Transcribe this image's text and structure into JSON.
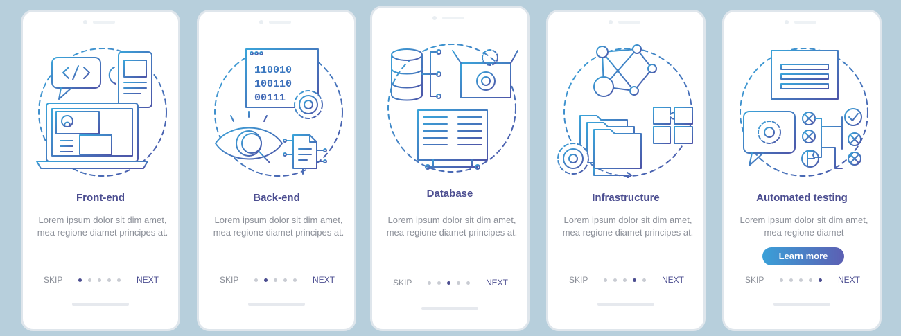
{
  "screens": [
    {
      "title": "Front-end",
      "desc": "Lorem ipsum dolor sit dim amet, mea regione diamet principes at.",
      "skip": "SKIP",
      "next": "NEXT",
      "active_page": 1
    },
    {
      "title": "Back-end",
      "desc": "Lorem ipsum dolor sit dim amet, mea regione diamet principes at.",
      "skip": "SKIP",
      "next": "NEXT",
      "active_page": 2
    },
    {
      "title": "Database",
      "desc": "Lorem ipsum dolor sit dim amet, mea regione diamet principes at.",
      "skip": "SKIP",
      "next": "NEXT",
      "active_page": 3
    },
    {
      "title": "Infrastructure",
      "desc": "Lorem ipsum dolor sit dim amet, mea regione diamet principes at.",
      "skip": "SKIP",
      "next": "NEXT",
      "active_page": 4
    },
    {
      "title": "Automated testing",
      "desc": "Lorem ipsum dolor sit dim amet, mea regione diamet",
      "skip": "SKIP",
      "next": "NEXT",
      "active_page": 5,
      "button": "Learn more"
    }
  ],
  "page_count": 5,
  "icons": {
    "s1": [
      "code-chat-icon",
      "smartphone-icon",
      "laptop-icon",
      "user-profile-icon"
    ],
    "s2": [
      "binary-window-icon",
      "gear-icon",
      "eye-magnifier-icon",
      "document-circuit-icon"
    ],
    "s3": [
      "database-icon",
      "gear-box-icon",
      "server-rack-icon"
    ],
    "s4": [
      "network-nodes-icon",
      "folders-icon",
      "gear-icon",
      "puzzle-icon"
    ],
    "s5": [
      "list-window-icon",
      "gear-chat-icon",
      "checklist-icon",
      "flag-icon"
    ]
  },
  "colors": {
    "accent": "#4b4d90",
    "gradient_start": "#3aa0d8",
    "gradient_end": "#5c5fb3",
    "background": "#b7cfdc"
  },
  "binary": [
    "110010",
    "100110",
    "00111"
  ]
}
